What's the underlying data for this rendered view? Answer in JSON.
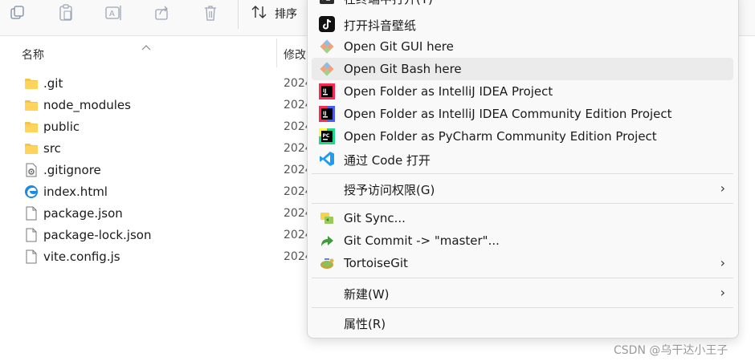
{
  "toolbar": {
    "sort_label": "排序"
  },
  "file_list": {
    "col_name": "名称",
    "col_modified": "修改",
    "date_prefix": "2024",
    "files": [
      {
        "name": ".git",
        "icon": "folder-icon"
      },
      {
        "name": "node_modules",
        "icon": "folder-icon"
      },
      {
        "name": "public",
        "icon": "folder-icon"
      },
      {
        "name": "src",
        "icon": "folder-icon"
      },
      {
        "name": ".gitignore",
        "icon": "settings-file-icon"
      },
      {
        "name": "index.html",
        "icon": "edge-html-icon"
      },
      {
        "name": "package.json",
        "icon": "document-icon"
      },
      {
        "name": "package-lock.json",
        "icon": "document-icon"
      },
      {
        "name": "vite.config.js",
        "icon": "document-icon"
      }
    ]
  },
  "context_menu": {
    "items": [
      {
        "label": "在终端中打开(T)",
        "icon": "terminal-icon"
      },
      {
        "label": "打开抖音壁纸",
        "icon": "tiktok-icon"
      },
      {
        "label": "Open Git GUI here",
        "icon": "git-icon"
      },
      {
        "label": "Open Git Bash here",
        "icon": "git-icon"
      },
      {
        "label": "Open Folder as IntelliJ IDEA Project",
        "icon": "intellij-icon"
      },
      {
        "label": "Open Folder as IntelliJ IDEA Community Edition Project",
        "icon": "intellij-ce-icon"
      },
      {
        "label": "Open Folder as PyCharm Community Edition Project",
        "icon": "pycharm-icon"
      },
      {
        "label": "通过 Code 打开",
        "icon": "vscode-icon"
      },
      {
        "label": "授予访问权限(G)",
        "icon": ""
      },
      {
        "label": "Git Sync...",
        "icon": "git-sync-icon"
      },
      {
        "label": "Git Commit -> \"master\"...",
        "icon": "git-commit-icon"
      },
      {
        "label": "TortoiseGit",
        "icon": "tortoisegit-icon"
      },
      {
        "label": "新建(W)",
        "icon": ""
      },
      {
        "label": "属性(R)",
        "icon": ""
      }
    ],
    "highlighted_index": 3
  },
  "watermark": "CSDN @乌干达小王子"
}
